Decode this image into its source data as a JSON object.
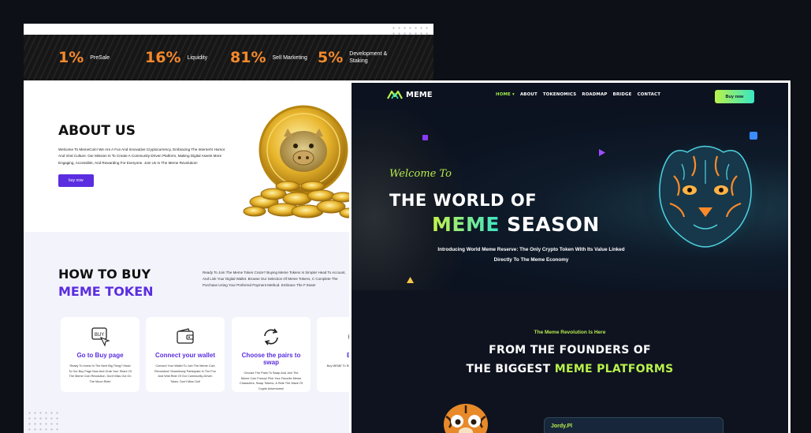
{
  "left_page": {
    "stats": [
      {
        "value": "1%",
        "label": "PreSale"
      },
      {
        "value": "16%",
        "label": "Liquidity"
      },
      {
        "value": "81%",
        "label": "Sell Marketing"
      },
      {
        "value": "5%",
        "label": "Development & Staking"
      }
    ],
    "about": {
      "title": "ABOUT US",
      "text": "Welcome To MemeCoin! We Are A Fun And Innovative Cryptocurrency, Embracing The Internet's Humor And Viral Culture. Our Mission Is To Create A Community-Driven Platform, Making Digital Assets More Engaging, Accessible, And Rewarding For Everyone. Join Us In The Meme Revolution!",
      "button": "buy now"
    },
    "how_to_buy": {
      "title_line1": "HOW TO BUY",
      "title_line2": "MEME TOKEN",
      "description": "Ready To Join The Meme Token Craze? Buying Meme Tokens Is Simple! Head To Account, And Link Your Digital Wallet. Browse Our Selection Of Meme Tokens, C Complete The Purchase Using Your Preferred Payment Method. Embrace The F Ease!",
      "cards": [
        {
          "icon": "buy-cart-icon",
          "title": "Go to Buy page",
          "text": "Ready To Invest In The Next Big Thing? Head To Our Buy Page Now And Grab Your Share Of The Meme Coin Revolution. Don't Miss Out On The Moon Ride!"
        },
        {
          "icon": "wallet-icon",
          "title": "Connect your wallet",
          "text": "Connect Your Wallet To Join The Meme Coin Revolution! Seamlessly Participate In The Fun And Wild Ride Of Our Community-Driven Token. Don't Miss Out!"
        },
        {
          "icon": "swap-arrows-icon",
          "title": "Choose the pairs to swap",
          "text": "Choose The Pairs To Swap And Join The Meme Coin Frenzy! Pick Your Favorite Meme Characters, Swap Tokens, & Ride The Wave Of Crypto Adventures!"
        },
        {
          "icon": "coin-icon",
          "title": "Buy M",
          "text": "Buy MEME To Revolutionize Potential Gains Meme C"
        }
      ]
    }
  },
  "right_page": {
    "nav": {
      "logo": "MEME",
      "items": [
        {
          "label": "HOME",
          "has_dropdown": true
        },
        {
          "label": "ABOUT"
        },
        {
          "label": "TOKENOMICS"
        },
        {
          "label": "ROADMAP"
        },
        {
          "label": "BRIDGE"
        },
        {
          "label": "CONTACT"
        }
      ],
      "buy_button": "Buy now"
    },
    "hero": {
      "welcome": "Welcome To",
      "line1": "THE WORLD OF",
      "line2_accent": "MEME",
      "line2_rest": "SEASON",
      "subtitle": "Introducing World Meme Reserve: The Only Crypto Token With Its Value Linked Directly To The Meme Economy"
    },
    "founders": {
      "kicker": "The Meme Revolution Is Here",
      "line1": "FROM THE FOUNDERS OF",
      "line2_rest": "THE BIGGEST",
      "line2_accent": "MEME PLATFORMS",
      "card_name": "Jordy.Pl"
    }
  },
  "colors": {
    "background": "#0e1018",
    "orange": "#f5892b",
    "purple": "#5a2de0",
    "lime": "#b8f24a",
    "teal": "#39e6c4"
  }
}
